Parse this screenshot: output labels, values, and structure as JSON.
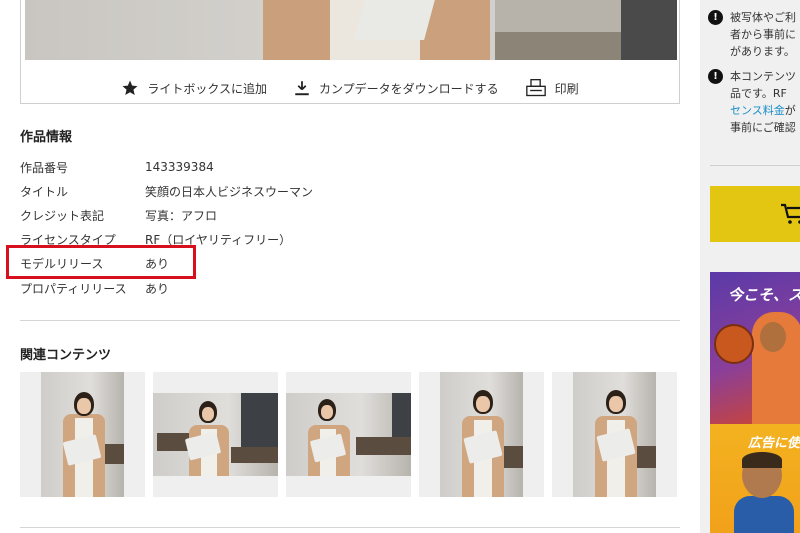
{
  "hero": {
    "actions": {
      "lightbox": "ライトボックスに追加",
      "download": "カンプデータをダウンロードする",
      "print": "印刷"
    },
    "action_icons": [
      "star-icon",
      "download-icon",
      "print-icon"
    ]
  },
  "info": {
    "title": "作品情報",
    "rows": [
      {
        "label": "作品番号",
        "value": "143339384"
      },
      {
        "label": "タイトル",
        "value": "笑顔の日本人ビジネスウーマン"
      },
      {
        "label": "クレジット表記",
        "value": "写真：アフロ"
      },
      {
        "label": "ライセンスタイプ",
        "value": "RF（ロイヤリティフリー）"
      },
      {
        "label": "モデルリリース",
        "value": "あり"
      },
      {
        "label": "プロパティリリース",
        "value": "あり"
      }
    ],
    "highlight_color": "#d80f1c"
  },
  "related": {
    "title": "関連コンテンツ"
  },
  "sidebar": {
    "notice1": {
      "line1": "被写体やご利",
      "line2": "者から事前に",
      "line3": "があります。"
    },
    "notice2": {
      "line1": "本コンテンツ",
      "line2": "品です。RF",
      "link": "センス料金",
      "link_suffix": "が",
      "line4": "事前にご確認"
    },
    "cart_color": "#e2c612",
    "link_color": "#1a8fc9",
    "ad": {
      "headline": "今こそ、ス",
      "subline": "広告に使"
    }
  }
}
